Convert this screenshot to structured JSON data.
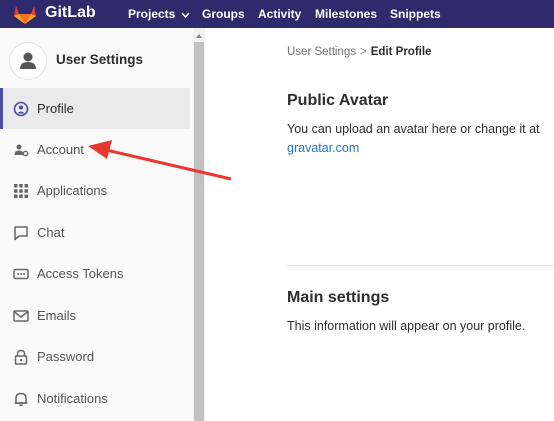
{
  "header": {
    "brand": "GitLab",
    "nav": [
      {
        "label": "Projects",
        "has_dropdown": true
      },
      {
        "label": "Groups"
      },
      {
        "label": "Activity"
      },
      {
        "label": "Milestones"
      },
      {
        "label": "Snippets"
      }
    ]
  },
  "sidebar": {
    "title": "User Settings",
    "items": [
      {
        "label": "Profile",
        "icon": "profile-icon",
        "active": true
      },
      {
        "label": "Account",
        "icon": "account-icon"
      },
      {
        "label": "Applications",
        "icon": "applications-icon"
      },
      {
        "label": "Chat",
        "icon": "chat-icon"
      },
      {
        "label": "Access Tokens",
        "icon": "access-tokens-icon"
      },
      {
        "label": "Emails",
        "icon": "emails-icon"
      },
      {
        "label": "Password",
        "icon": "lock-icon"
      },
      {
        "label": "Notifications",
        "icon": "bell-icon"
      }
    ]
  },
  "breadcrumb": {
    "parent": "User Settings",
    "separator": ">",
    "current": "Edit Profile"
  },
  "main": {
    "avatar_section": {
      "title": "Public Avatar",
      "text": "You can upload an avatar here or change it at",
      "link": "gravatar.com"
    },
    "main_settings": {
      "title": "Main settings",
      "text": "This information will appear on your profile."
    }
  },
  "colors": {
    "topbar": "#2f2a6b",
    "active_border": "#4b4ba3",
    "link": "#1f78d1",
    "arrow": "#e8382f"
  }
}
